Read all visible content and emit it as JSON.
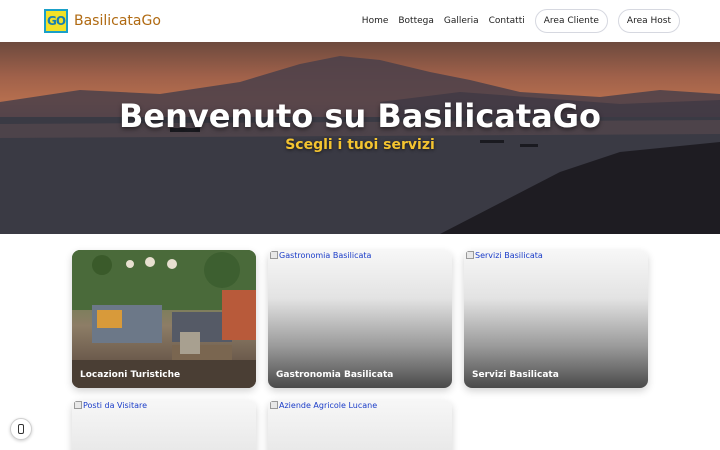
{
  "header": {
    "logo_text": "GO",
    "brand": "BasilicataGo",
    "nav": [
      "Home",
      "Bottega",
      "Galleria",
      "Contatti"
    ],
    "area_cliente": "Area Cliente",
    "area_host": "Area Host"
  },
  "hero": {
    "title": "Benvenuto su BasilicataGo",
    "subtitle": "Scegli i tuoi servizi"
  },
  "cards": [
    {
      "alt": "",
      "label": "Locazioni Turistiche"
    },
    {
      "alt": "Gastronomia Basilicata",
      "label": "Gastronomia Basilicata"
    },
    {
      "alt": "Servizi Basilicata",
      "label": "Servizi Basilicata"
    },
    {
      "alt": "Posti da Visitare",
      "label": ""
    },
    {
      "alt": "Aziende Agricole Lucane",
      "label": ""
    }
  ],
  "colors": {
    "brand": "#b06a12",
    "subtitle": "#f4c430",
    "logo_bg": "#f2e227"
  }
}
